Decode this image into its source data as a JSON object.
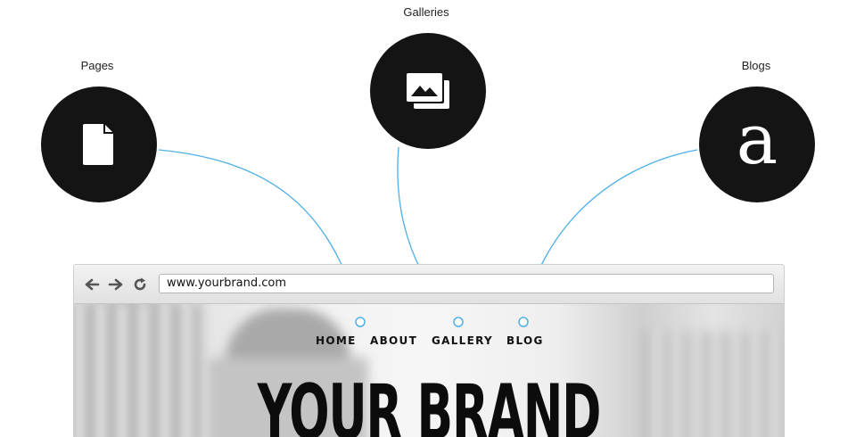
{
  "features": [
    {
      "label": "Pages",
      "icon": "page-icon"
    },
    {
      "label": "Galleries",
      "icon": "gallery-icon"
    },
    {
      "label": "Blogs",
      "icon": "blog-icon",
      "glyph": "a"
    }
  ],
  "browser": {
    "url": "www.yourbrand.com",
    "nav_icons": [
      "back-arrow-icon",
      "forward-arrow-icon",
      "reload-icon"
    ]
  },
  "site": {
    "nav": [
      "HOME",
      "ABOUT",
      "GALLERY",
      "BLOG"
    ],
    "title": "YOUR BRAND"
  },
  "colors": {
    "circle": "#141414",
    "connector": "#4fb0e8"
  }
}
